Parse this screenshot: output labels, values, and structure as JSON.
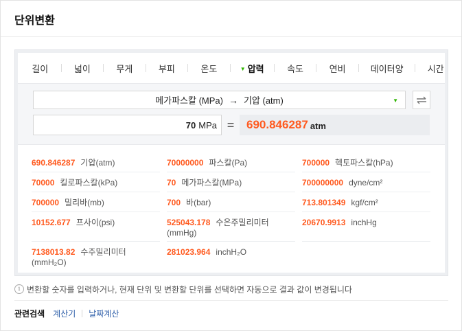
{
  "widget": {
    "title": "단위변환"
  },
  "tabs": [
    {
      "label": "길이"
    },
    {
      "label": "넓이"
    },
    {
      "label": "무게"
    },
    {
      "label": "부피"
    },
    {
      "label": "온도"
    },
    {
      "label": "압력",
      "active": true
    },
    {
      "label": "속도"
    },
    {
      "label": "연비"
    },
    {
      "label": "데이터양"
    },
    {
      "label": "시간"
    }
  ],
  "converter": {
    "from_unit": "메가파스칼 (MPa)",
    "arrow": "→",
    "to_unit": "기압 (atm)",
    "input_value": "70",
    "input_unit": "MPa",
    "equals": "=",
    "result_value": "690.846287",
    "result_unit": "atm"
  },
  "results": [
    {
      "value": "690.846287",
      "unit": "기압(atm)"
    },
    {
      "value": "70000000",
      "unit": "파스칼(Pa)"
    },
    {
      "value": "700000",
      "unit": "헥토파스칼(hPa)"
    },
    {
      "value": "70000",
      "unit": "킬로파스칼(kPa)"
    },
    {
      "value": "70",
      "unit": "메가파스칼(MPa)"
    },
    {
      "value": "700000000",
      "unit": "dyne/cm²"
    },
    {
      "value": "700000",
      "unit": "밀리바(mb)"
    },
    {
      "value": "700",
      "unit": "바(bar)"
    },
    {
      "value": "713.801349",
      "unit": "kgf/cm²"
    },
    {
      "value": "10152.677",
      "unit": "프사이(psi)"
    },
    {
      "value": "525043.178",
      "unit": "수은주밀리미터 (mmHg)"
    },
    {
      "value": "20670.9913",
      "unit": "inchHg"
    },
    {
      "value": "7138013.82",
      "unit": "수주밀리미터 (mmH₂O)"
    },
    {
      "value": "281023.964",
      "unit": "inchH₂O"
    }
  ],
  "info": {
    "icon": "info-icon",
    "text": "변환할 숫자를 입력하거나, 현재 단위 및 변환할 단위를 선택하면 자동으로 결과 값이 변경됩니다"
  },
  "related": {
    "label": "관련검색",
    "links": [
      "계산기",
      "날짜계산"
    ]
  },
  "colors": {
    "accent": "#ff5a1f",
    "caret": "#2db400",
    "link": "#2b5ca8"
  }
}
